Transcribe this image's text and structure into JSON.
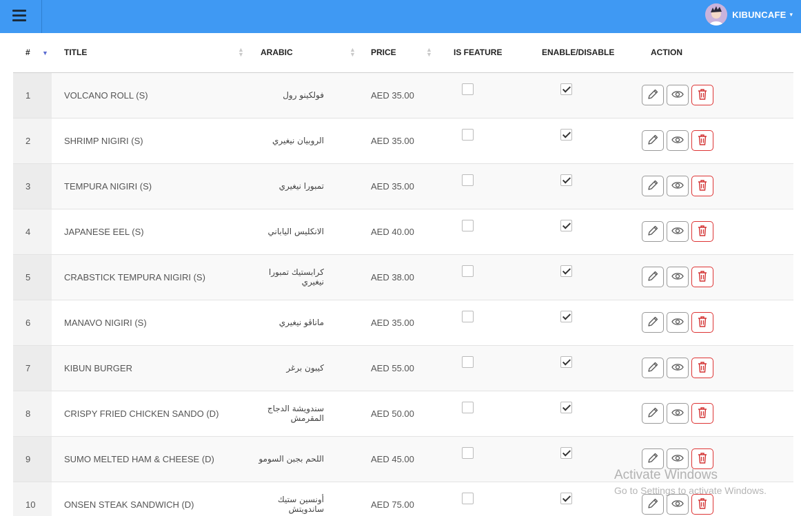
{
  "header": {
    "username": "KIBUNCAFE",
    "caret": "▾"
  },
  "table": {
    "columns": {
      "num": "#",
      "title": "TITLE",
      "arabic": "ARABIC",
      "price": "PRICE",
      "is_feature": "IS FEATURE",
      "enable": "ENABLE/DISABLE",
      "action": "ACTION"
    },
    "rows": [
      {
        "num": "1",
        "title": "VOLCANO ROLL (S)",
        "arabic": "فولكينو رول",
        "price": "AED 35.00",
        "featured": false,
        "enabled": true
      },
      {
        "num": "2",
        "title": "SHRIMP NIGIRI (S)",
        "arabic": "الروبيان نيغيري",
        "price": "AED 35.00",
        "featured": false,
        "enabled": true
      },
      {
        "num": "3",
        "title": "TEMPURA NIGIRI (S)",
        "arabic": "تمبورا نيغيري",
        "price": "AED 35.00",
        "featured": false,
        "enabled": true
      },
      {
        "num": "4",
        "title": "JAPANESE EEL (S)",
        "arabic": "الانكليس الياباني",
        "price": "AED 40.00",
        "featured": false,
        "enabled": true
      },
      {
        "num": "5",
        "title": "CRABSTICK TEMPURA NIGIRI (S)",
        "arabic": "كرابستيك تمبورا نيغيري",
        "price": "AED 38.00",
        "featured": false,
        "enabled": true
      },
      {
        "num": "6",
        "title": "MANAVO NIGIRI (S)",
        "arabic": "ماناڤو نيغيري",
        "price": "AED 35.00",
        "featured": false,
        "enabled": true
      },
      {
        "num": "7",
        "title": "KIBUN BURGER",
        "arabic": "كيبون برغر",
        "price": "AED 55.00",
        "featured": false,
        "enabled": true
      },
      {
        "num": "8",
        "title": "CRISPY FRIED CHICKEN SANDO (D)",
        "arabic": "سندويشة الدجاج المقرمش",
        "price": "AED 50.00",
        "featured": false,
        "enabled": true
      },
      {
        "num": "9",
        "title": "SUMO MELTED HAM & CHEESE (D)",
        "arabic": "اللحم بجبن السومو",
        "price": "AED 45.00",
        "featured": false,
        "enabled": true
      },
      {
        "num": "10",
        "title": "ONSEN STEAK SANDWICH (D)",
        "arabic": "أونسين ستيك ساندويتش",
        "price": "AED 75.00",
        "featured": false,
        "enabled": true
      }
    ]
  },
  "watermark": {
    "line1": "Activate Windows",
    "line2": "Go to Settings to activate Windows."
  },
  "colors": {
    "topbar": "#3f99f3",
    "delete": "#d33333"
  },
  "icons": {
    "menu": "hamburger-icon",
    "edit": "pencil-icon",
    "view": "eye-icon",
    "delete": "trash-icon"
  }
}
